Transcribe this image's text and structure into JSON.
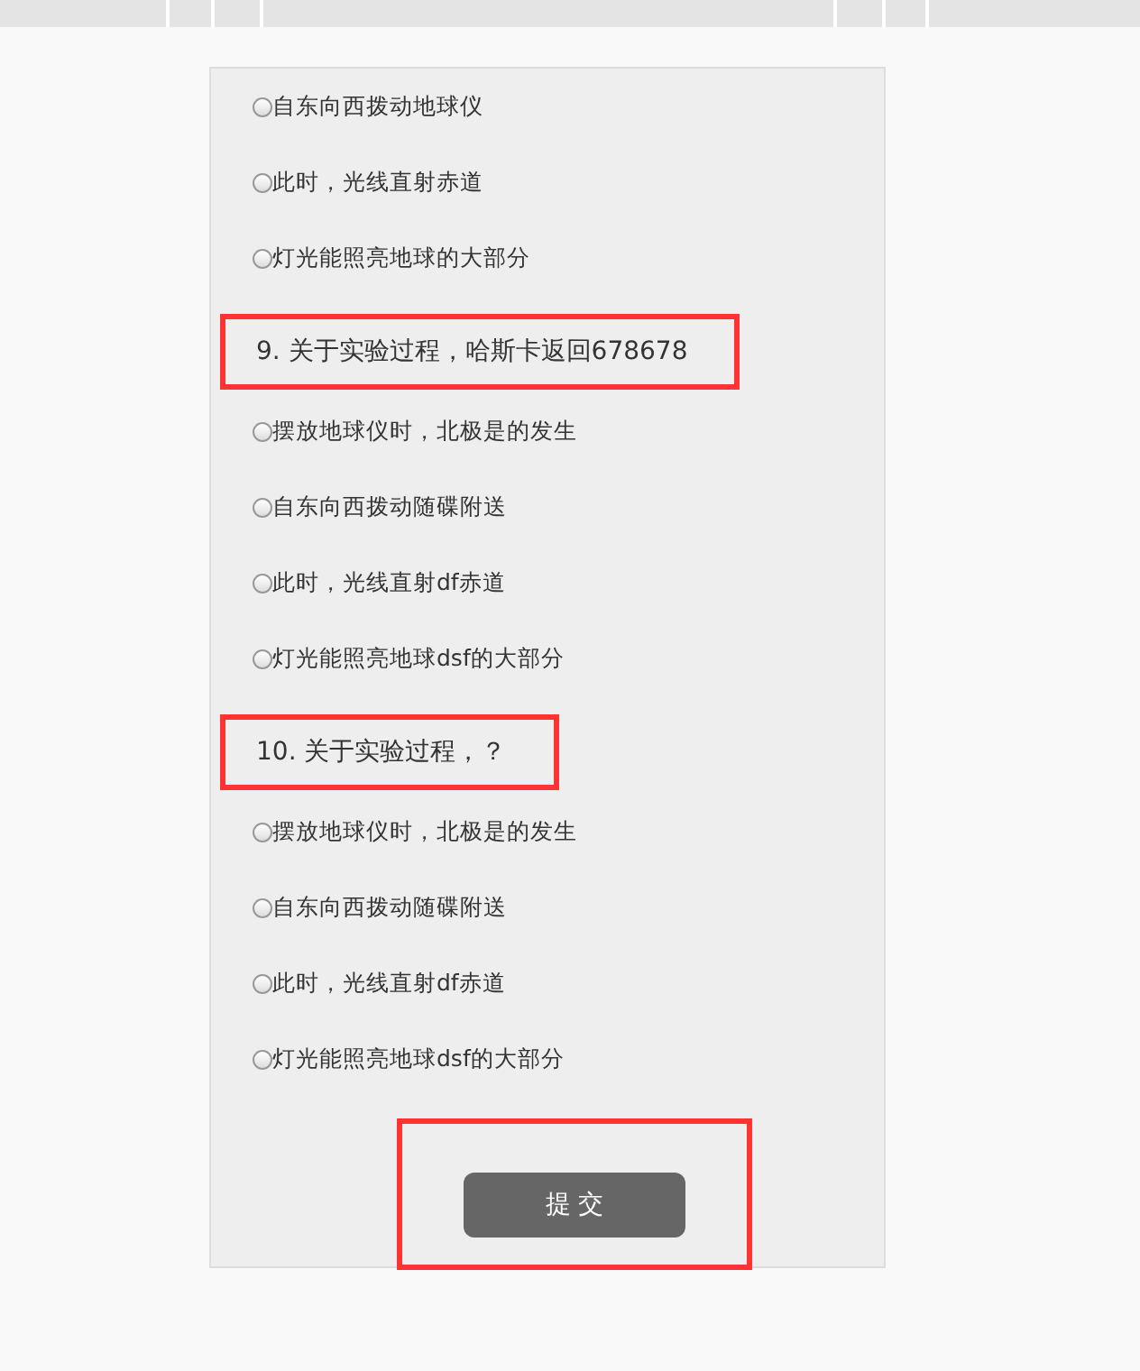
{
  "items": [
    {
      "kind": "option",
      "label": "自东向西拨动地球仪",
      "selected": false
    },
    {
      "kind": "option",
      "label": "此时，光线直射赤道",
      "selected": false
    },
    {
      "kind": "option",
      "label": "灯光能照亮地球的大部分",
      "selected": false
    },
    {
      "kind": "question",
      "label": "9. 关于实验过程，哈斯卡返回678678",
      "highlighted": true
    },
    {
      "kind": "option",
      "label": "摆放地球仪时，北极是的发生",
      "selected": false
    },
    {
      "kind": "option",
      "label": "自东向西拨动随碟附送",
      "selected": false
    },
    {
      "kind": "option",
      "label": "此时，光线直射df赤道",
      "selected": false
    },
    {
      "kind": "option",
      "label": "灯光能照亮地球dsf的大部分",
      "selected": false
    },
    {
      "kind": "question",
      "label": "10. 关于实验过程，？",
      "highlighted": true
    },
    {
      "kind": "option",
      "label": "摆放地球仪时，北极是的发生",
      "selected": false
    },
    {
      "kind": "option",
      "label": "自东向西拨动随碟附送",
      "selected": false
    },
    {
      "kind": "option",
      "label": "此时，光线直射df赤道",
      "selected": false
    },
    {
      "kind": "option",
      "label": "灯光能照亮地球dsf的大部分",
      "selected": false
    }
  ],
  "submit": {
    "label": "提 交",
    "highlighted": true
  }
}
